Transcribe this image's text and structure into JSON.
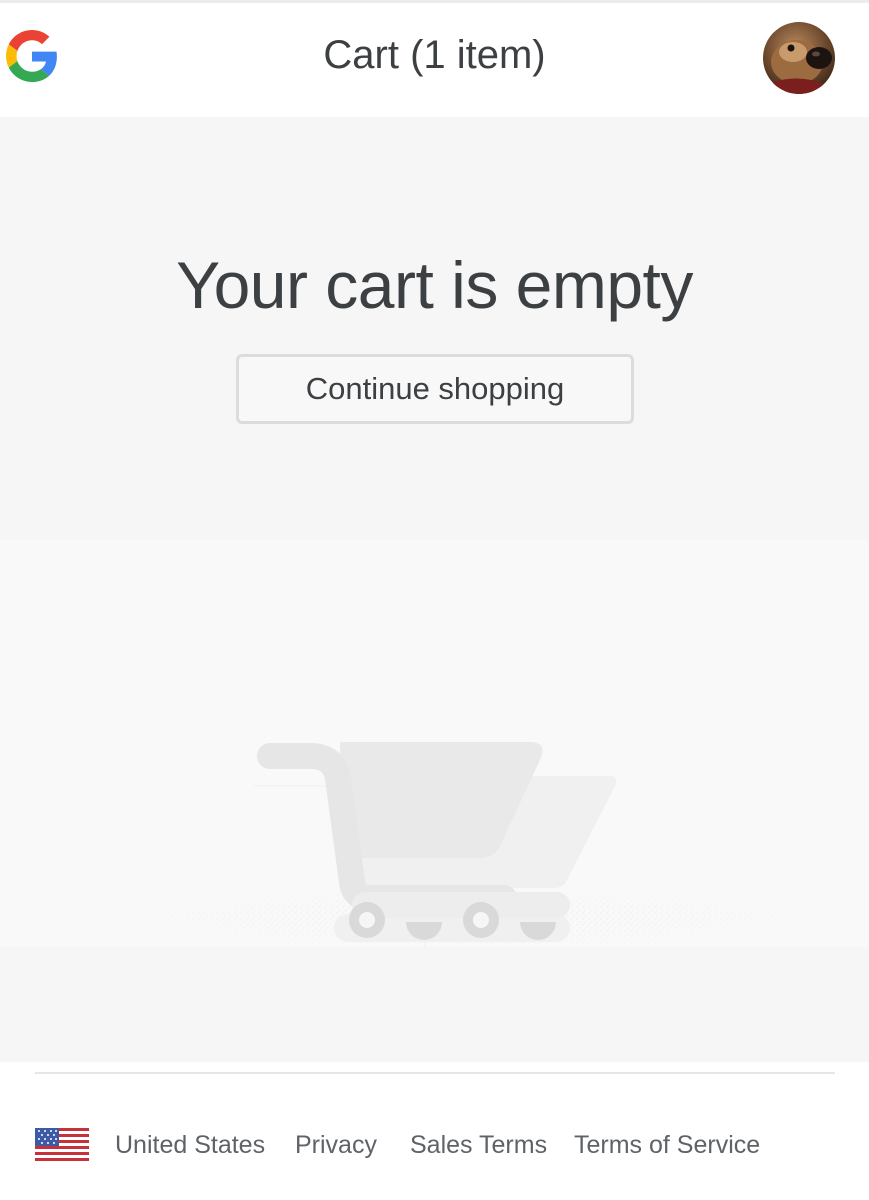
{
  "header": {
    "title": "Cart",
    "item_count": "(1 item)",
    "logo_icon": "google-g-icon",
    "avatar_icon": "user-avatar"
  },
  "main": {
    "heading": "Your cart is empty",
    "continue_label": "Continue shopping",
    "illustration_icon": "shopping-cart-icon"
  },
  "footer": {
    "flag_icon": "us-flag-icon",
    "links": [
      {
        "label": "United States"
      },
      {
        "label": "Privacy"
      },
      {
        "label": "Sales Terms"
      },
      {
        "label": "Terms of Service"
      }
    ]
  },
  "colors": {
    "text": "#3c4043",
    "muted_text": "#5f6368",
    "main_bg": "#f6f6f6",
    "google_blue": "#4285f4",
    "google_red": "#ea4335",
    "google_yellow": "#fbbc05",
    "google_green": "#34a853"
  }
}
